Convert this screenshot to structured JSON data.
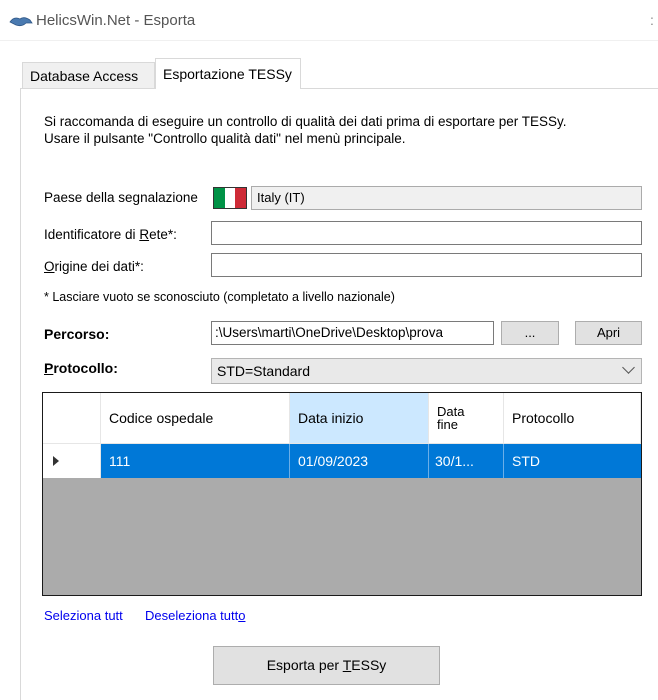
{
  "window": {
    "title": "HelicsWin.Net - Esporta",
    "title_extra": ":"
  },
  "tabs": [
    {
      "label": "Database Access"
    },
    {
      "label": "Esportazione TESSy"
    }
  ],
  "info": {
    "line1": "Si raccomanda di eseguire un controllo di qualità dei dati prima di esportare per TESSy.",
    "line2": "Usare il pulsante \"Controllo qualità dati\" nel menù principale."
  },
  "form": {
    "country_label": "Paese della segnalazione",
    "country_value": "Italy (IT)",
    "network_label_pre": "Identificatore di ",
    "network_label_u": "R",
    "network_label_post": "ete*:",
    "network_value": "",
    "origin_label_u": "O",
    "origin_label_post": "rigine dei dati*:",
    "origin_value": "",
    "note": "* Lasciare vuoto se sconosciuto (completato a livello nazionale)",
    "path_label": "Percorso:",
    "path_value": ":\\Users\\marti\\OneDrive\\Desktop\\prova",
    "browse_label": "...",
    "open_label": "Apri",
    "protocol_label_u": "P",
    "protocol_label_post": "rotocollo:",
    "protocol_value": "STD=Standard"
  },
  "grid": {
    "columns": [
      "Codice ospedale",
      "Data inizio",
      "Data fine",
      "Protocollo"
    ],
    "rows": [
      {
        "codice": "111",
        "data_inizio": "01/09/2023",
        "data_fine": "30/1...",
        "protocollo": "STD"
      }
    ]
  },
  "links": {
    "select_all": "Seleziona tutt",
    "deselect_all_pre": "Deseleziona tutt",
    "deselect_all_u": "o"
  },
  "export_button": {
    "pre": "Esporta per ",
    "u": "T",
    "post": "ESSy"
  },
  "colors": {
    "selection": "#0078d7",
    "header_selected": "#cce8ff",
    "flag_green": "#009246",
    "flag_red": "#ce2b37"
  }
}
